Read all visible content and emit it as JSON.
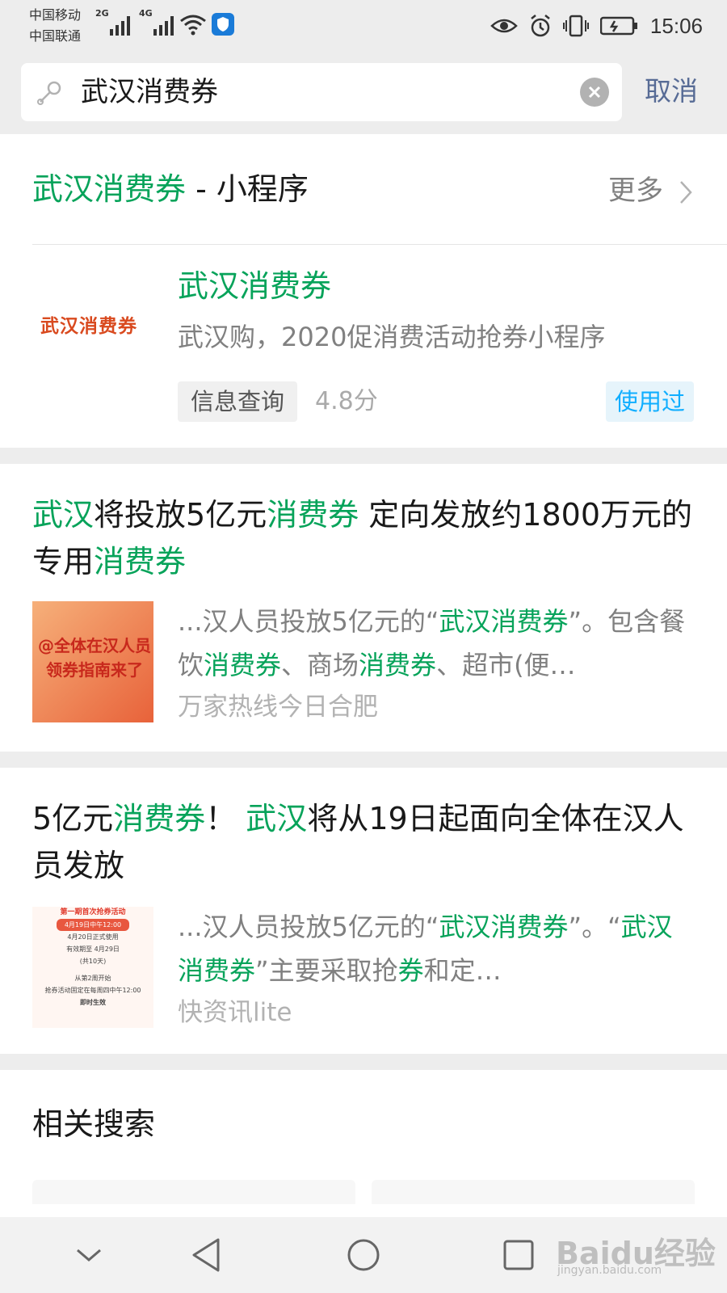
{
  "status_bar": {
    "carrier_1": "中国移动",
    "carrier_2": "中国联通",
    "net_1": "2G",
    "net_2": "4G",
    "time": "15:06"
  },
  "search": {
    "query": "武汉消费券",
    "cancel_label": "取消"
  },
  "mini_program_section": {
    "title_keyword": "武汉消费券",
    "title_suffix": " - 小程序",
    "more_label": "更多",
    "result": {
      "logo_text": "武汉消费券",
      "name": "武汉消费券",
      "description": "武汉购，2020促消费活动抢券小程序",
      "tag": "信息查询",
      "rating": "4.8分",
      "used_badge": "使用过"
    }
  },
  "articles": [
    {
      "title_parts": [
        {
          "text": "武汉",
          "hl": true
        },
        {
          "text": "将投放5亿元",
          "hl": false
        },
        {
          "text": "消费券",
          "hl": true
        },
        {
          "text": " 定向发放约1800万元的专用",
          "hl": false
        },
        {
          "text": "消费券",
          "hl": true
        }
      ],
      "thumb_lines": [
        "@全体在汉人员",
        "领券指南来了"
      ],
      "snippet_parts": [
        {
          "text": "...汉人员投放5亿元的“",
          "hl": false
        },
        {
          "text": "武汉消费券",
          "hl": true
        },
        {
          "text": "”。包含餐饮",
          "hl": false
        },
        {
          "text": "消费券",
          "hl": true
        },
        {
          "text": "、商场",
          "hl": false
        },
        {
          "text": "消费券",
          "hl": true
        },
        {
          "text": "、超市(便…",
          "hl": false
        }
      ],
      "source": "万家热线今日合肥"
    },
    {
      "title_parts": [
        {
          "text": "5亿元",
          "hl": false
        },
        {
          "text": "消费券",
          "hl": true
        },
        {
          "text": "！ ",
          "hl": false
        },
        {
          "text": "武汉",
          "hl": true
        },
        {
          "text": "将从19日起面向全体在汉人员发放",
          "hl": false
        }
      ],
      "thumb_lines": [
        "第一期首次抢券活动",
        "4月19日中午12:00",
        "4月20日正式使用",
        "有效期至 4月29日",
        "(共10天)",
        "从第2周开始",
        "抢券活动固定在每周四中午12:00",
        "即时生效"
      ],
      "snippet_parts": [
        {
          "text": "...汉人员投放5亿元的“",
          "hl": false
        },
        {
          "text": "武汉消费券",
          "hl": true
        },
        {
          "text": "”。“",
          "hl": false
        },
        {
          "text": "武汉消费券",
          "hl": true
        },
        {
          "text": "”主要采取抢",
          "hl": false
        },
        {
          "text": "券",
          "hl": true
        },
        {
          "text": "和定…",
          "hl": false
        }
      ],
      "source": "快资讯lite"
    }
  ],
  "related": {
    "title": "相关搜索"
  },
  "watermark": {
    "brand": "Baidu经验",
    "url": "jingyan.baidu.com"
  },
  "colors": {
    "highlight": "#07a35a",
    "link_blue": "#576b95",
    "badge_blue": "#10aeff",
    "logo_red": "#d94a1f"
  }
}
